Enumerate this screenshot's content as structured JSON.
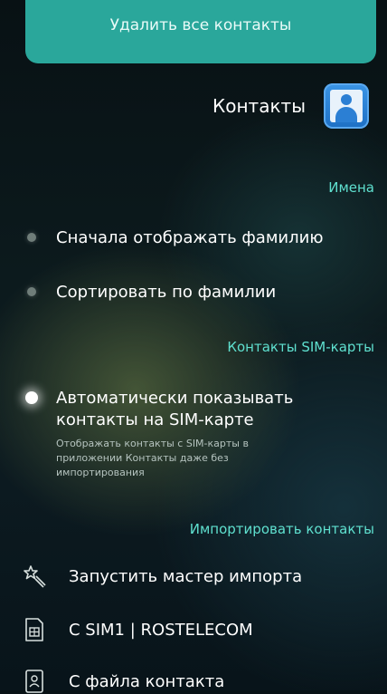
{
  "top_action": {
    "label": "Удалить все контакты"
  },
  "header": {
    "title": "Контакты",
    "icon": "contacts-app-icon"
  },
  "sections": {
    "names": "Имена",
    "sim": "Контакты SIM-карты",
    "import": "Импортировать контакты"
  },
  "names": {
    "item1": "Сначала отображать фамилию",
    "item2": "Сортировать по фамилии"
  },
  "sim": {
    "title_line1": "Автоматически показывать",
    "title_line2": "контакты на SIM-карте",
    "subtitle": "Отображать контакты с SIM-карты в приложении Контакты даже без импортирования"
  },
  "import": {
    "wizard": "Запустить мастер импорта",
    "sim1": "С SIM1 | ROSTELECOM",
    "file": "С файла контакта"
  }
}
